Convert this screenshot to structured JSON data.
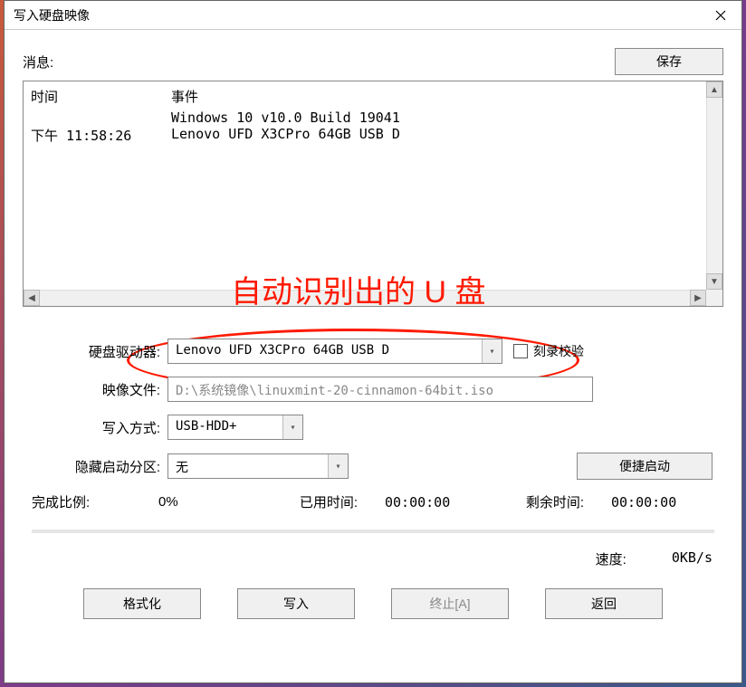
{
  "window": {
    "title": "写入硬盘映像"
  },
  "top": {
    "message_label": "消息:",
    "save_button": "保存"
  },
  "log": {
    "header_time": "时间",
    "header_event": "事件",
    "rows": [
      {
        "time": "",
        "event": "Windows 10 v10.0 Build 19041"
      },
      {
        "time": "下午 11:58:26",
        "event": "Lenovo UFD X3CPro 64GB USB D"
      }
    ]
  },
  "form": {
    "drive_label": "硬盘驱动器:",
    "drive_value": "Lenovo UFD X3CPro 64GB USB D",
    "verify_label": "刻录校验",
    "image_label": "映像文件:",
    "image_value": "D:\\系统镜像\\linuxmint-20-cinnamon-64bit.iso",
    "write_mode_label": "写入方式:",
    "write_mode_value": "USB-HDD+",
    "hidden_boot_label": "隐藏启动分区:",
    "hidden_boot_value": "无",
    "quick_boot_button": "便捷启动"
  },
  "status": {
    "done_ratio_label": "完成比例:",
    "done_ratio_value": "0%",
    "elapsed_label": "已用时间:",
    "elapsed_value": "00:00:00",
    "remaining_label": "剩余时间:",
    "remaining_value": "00:00:00",
    "speed_label": "速度:",
    "speed_value": "0KB/s"
  },
  "buttons": {
    "format": "格式化",
    "write": "写入",
    "abort": "终止[A]",
    "back": "返回"
  },
  "annotation": {
    "text": "自动识别出的 U 盘"
  }
}
